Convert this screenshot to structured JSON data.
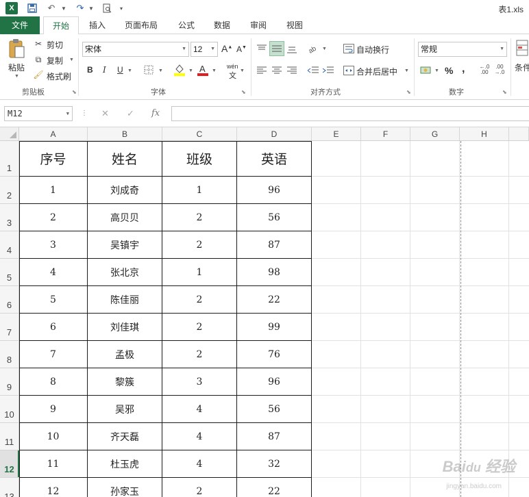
{
  "app": {
    "doc_title": "表1.xls",
    "logo_letter": "X"
  },
  "tabs": [
    {
      "label": "文件"
    },
    {
      "label": "开始"
    },
    {
      "label": "插入"
    },
    {
      "label": "页面布局"
    },
    {
      "label": "公式"
    },
    {
      "label": "数据"
    },
    {
      "label": "审阅"
    },
    {
      "label": "视图"
    }
  ],
  "ribbon": {
    "clipboard": {
      "paste": "粘贴",
      "cut": "剪切",
      "copy": "复制",
      "format_painter": "格式刷",
      "label": "剪贴板"
    },
    "font": {
      "name": "宋体",
      "size": "12",
      "label": "字体",
      "bold": "B",
      "italic": "I",
      "underline": "U",
      "grow": "A",
      "shrink": "A",
      "phonetic": "wén"
    },
    "alignment": {
      "wrap": "自动换行",
      "merge": "合并后居中",
      "label": "对齐方式"
    },
    "number": {
      "format": "常规",
      "percent": "%",
      "comma": ",",
      "label": "数字"
    },
    "styles": {
      "conditional": "条件"
    }
  },
  "formula_bar": {
    "name_box": "M12",
    "fx": "fx"
  },
  "colors": {
    "accent": "#217346",
    "tab_file_bg": "#217346",
    "grid_line": "#e1e1e1",
    "table_border": "#1a1a1a"
  },
  "sheet": {
    "columns": [
      "A",
      "B",
      "C",
      "D",
      "E",
      "F",
      "G",
      "H"
    ],
    "row_numbers": [
      "1",
      "2",
      "3",
      "4",
      "5",
      "6",
      "7",
      "8",
      "9",
      "10",
      "11",
      "12",
      "13"
    ],
    "selected_row": "12",
    "header": [
      "序号",
      "姓名",
      "班级",
      "英语"
    ],
    "rows": [
      [
        "1",
        "刘成奇",
        "1",
        "96"
      ],
      [
        "2",
        "高贝贝",
        "2",
        "56"
      ],
      [
        "3",
        "吴镇宇",
        "2",
        "87"
      ],
      [
        "4",
        "张北京",
        "1",
        "98"
      ],
      [
        "5",
        "陈佳丽",
        "2",
        "22"
      ],
      [
        "6",
        "刘佳琪",
        "2",
        "99"
      ],
      [
        "7",
        "孟极",
        "2",
        "76"
      ],
      [
        "8",
        "黎簇",
        "3",
        "96"
      ],
      [
        "9",
        "吴邪",
        "4",
        "56"
      ],
      [
        "10",
        "齐天磊",
        "4",
        "87"
      ],
      [
        "11",
        "杜玉虎",
        "4",
        "32"
      ],
      [
        "12",
        "孙家玉",
        "2",
        "22"
      ]
    ]
  }
}
